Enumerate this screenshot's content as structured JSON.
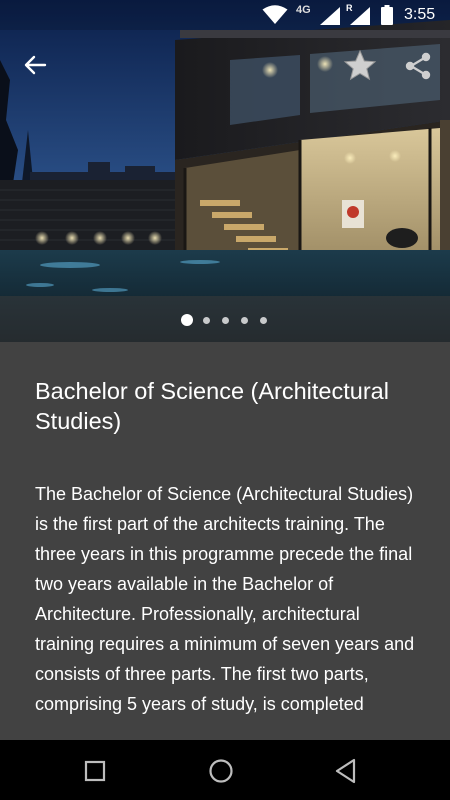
{
  "status_bar": {
    "network_label": "4G",
    "roaming_label": "R",
    "time": "3:55",
    "icons": [
      "wifi-icon",
      "signal-icon",
      "signal-roaming-icon",
      "battery-icon"
    ]
  },
  "hero": {
    "image_subject": "modern-house-night-pool-photo",
    "back_icon": "arrow-back-icon",
    "favorite_icon": "star-icon",
    "share_icon": "share-icon",
    "carousel": {
      "count": 5,
      "active_index": 0
    }
  },
  "content": {
    "title": "Bachelor of Science (Architectural Studies)",
    "description": "The Bachelor of Science (Architectural Studies) is the first part of the architects training. The three years in this programme precede the final two years available in the Bachelor of Architecture. Professionally, architectural training requires a minimum of seven years and consists of three parts. The first two parts, comprising 5 years of study, is completed"
  },
  "nav_bar": {
    "icons": [
      "recents-square-icon",
      "home-circle-icon",
      "back-triangle-icon"
    ]
  },
  "colors": {
    "content_background": "#424242",
    "text": "#ffffff",
    "nav_background": "#000000"
  }
}
